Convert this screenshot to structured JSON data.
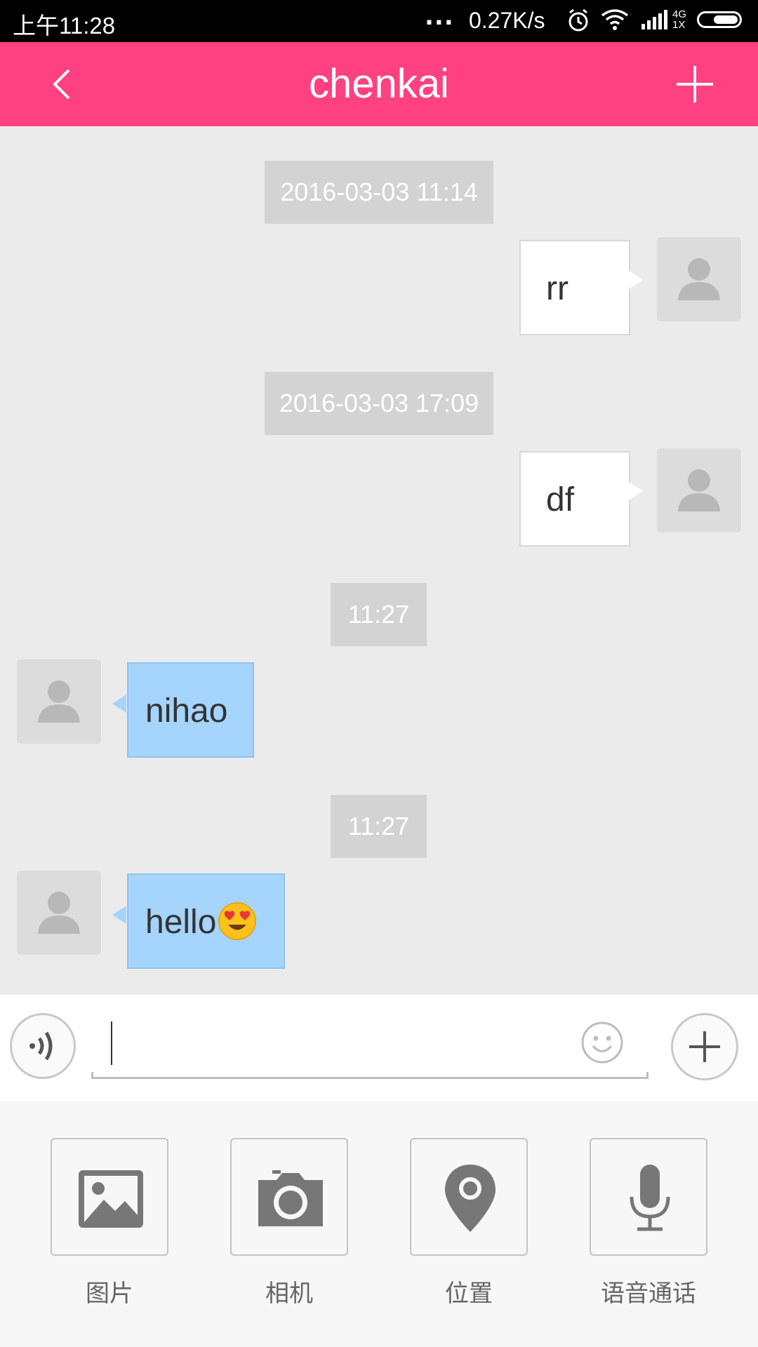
{
  "status_bar": {
    "time": "上午11:28",
    "dots": "...",
    "speed": "0.27K/s",
    "network_top": "4G",
    "network_bottom": "1X",
    "icons": [
      "alarm-icon",
      "wifi-icon",
      "signal-icon",
      "battery-icon"
    ]
  },
  "header": {
    "title": "chenkai",
    "back_icon": "chevron-left-icon",
    "add_icon": "plus-icon",
    "color": "#ff4081"
  },
  "messages": [
    {
      "timestamp": "2016-03-03 11:14",
      "side": "right",
      "text": "rr"
    },
    {
      "timestamp": "2016-03-03 17:09",
      "side": "right",
      "text": "df"
    },
    {
      "timestamp": "11:27",
      "side": "left",
      "text": "nihao"
    },
    {
      "timestamp": "11:27",
      "side": "left",
      "text": "hello",
      "emoji": "heart-eyes-emoji"
    }
  ],
  "input": {
    "value": "",
    "placeholder": "",
    "voice_icon": "voice-wave-icon",
    "emoji_icon": "smiley-icon",
    "plus_icon": "plus-icon"
  },
  "tools": [
    {
      "label": "图片",
      "icon": "image-icon"
    },
    {
      "label": "相机",
      "icon": "camera-icon"
    },
    {
      "label": "位置",
      "icon": "location-pin-icon"
    },
    {
      "label": "语音通话",
      "icon": "microphone-icon"
    }
  ],
  "colors": {
    "outgoing_bubble": "#ffffff",
    "incoming_bubble": "#a5d4fc",
    "timestamp_badge": "#d3d3d3",
    "chat_background": "#ebebeb"
  }
}
